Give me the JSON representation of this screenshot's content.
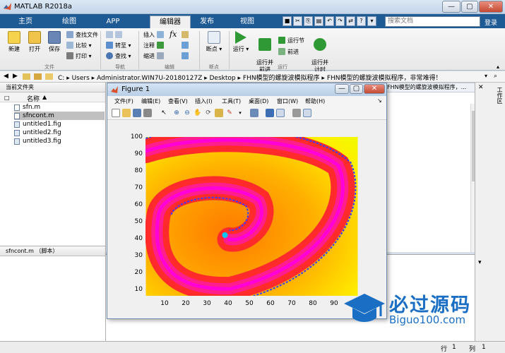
{
  "app": {
    "title": "MATLAB R2018a",
    "window_buttons": [
      "—",
      "▢",
      "✕"
    ]
  },
  "ribbon": {
    "tabs": [
      "主页",
      "绘图",
      "APP",
      "编辑器",
      "发布",
      "视图"
    ],
    "active_tab": "编辑器",
    "search_placeholder": "搜索文档",
    "sign_in": "登录",
    "file_group": {
      "new": "新建",
      "open": "打开",
      "save": "保存",
      "find_files": "查找文件",
      "compare": "比较",
      "print": "打印",
      "label": "文件"
    },
    "nav_group": {
      "goto": "转至",
      "find": "查找",
      "label": "导航"
    },
    "edit_group": {
      "insert": "插入",
      "fx": "fx",
      "comment": "注释",
      "indent": "缩进",
      "label": "编辑"
    },
    "breakpoint_group": {
      "breakpoint": "断点",
      "label": "断点"
    },
    "run_group": {
      "run": "运行",
      "run_advance": "运行并\n前进",
      "run_section": "运行节",
      "advance": "前进",
      "run_time": "运行并\n计时",
      "label": "运行"
    }
  },
  "address": {
    "segments": [
      "C:",
      "Users",
      "Administrator.WIN7U-20180127Z",
      "Desktop",
      "FHN模型的螺旋波模拟程序",
      "FHN模型的螺旋波模拟程序，非常难得！"
    ]
  },
  "folder_panel": {
    "title": "当前文件夹",
    "column": "名称",
    "files": [
      {
        "name": "sfn.m",
        "selected": false
      },
      {
        "name": "sfncont.m",
        "selected": true
      },
      {
        "name": "untitled1.fig",
        "selected": false
      },
      {
        "name": "untitled2.fig",
        "selected": false
      },
      {
        "name": "untitled3.fig",
        "selected": false
      }
    ],
    "details": "sfncont.m （脚本）"
  },
  "editor": {
    "tab_title": "FHN模型的螺旋波模拟程序，..."
  },
  "workspace": {
    "title": "工作区"
  },
  "figure": {
    "title": "Figure 1",
    "menu": [
      "文件(F)",
      "编辑(E)",
      "查看(V)",
      "插入(I)",
      "工具(T)",
      "桌面(D)",
      "窗口(W)",
      "帮助(H)"
    ],
    "y_ticks": [
      "100",
      "90",
      "80",
      "70",
      "60",
      "50",
      "40",
      "30",
      "20",
      "10"
    ],
    "x_ticks": [
      "10",
      "20",
      "30",
      "40",
      "50",
      "60",
      "70",
      "80",
      "90"
    ]
  },
  "status": {
    "row_label": "行",
    "row_value": "1",
    "col_label": "列",
    "col_value": "1"
  },
  "watermark": {
    "title": "必过源码",
    "url": "Biguo100.com"
  }
}
